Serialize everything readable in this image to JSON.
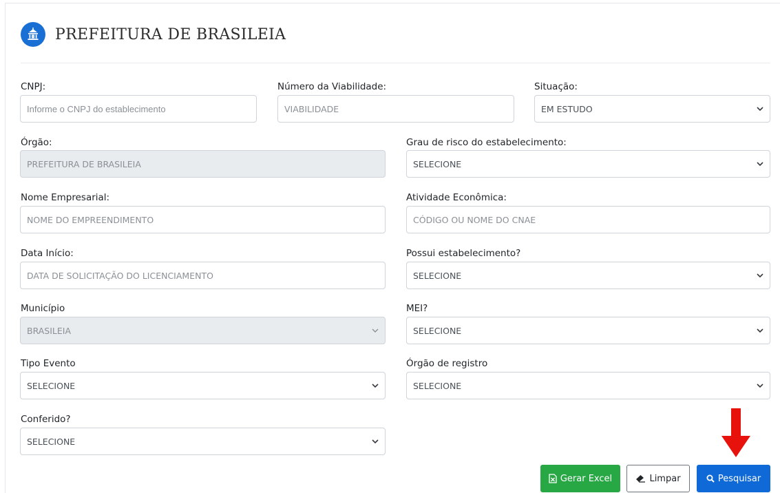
{
  "header": {
    "title": "PREFEITURA DE BRASILEIA",
    "logo_icon": "city-hall-icon",
    "accent_color": "#1a6fd4"
  },
  "form": {
    "cnpj": {
      "label": "CNPJ:",
      "placeholder": "Informe o CNPJ do establecimento"
    },
    "viabilidade": {
      "label": "Número da Viabilidade:",
      "placeholder": "VIABILIDADE"
    },
    "situacao": {
      "label": "Situação:",
      "value": "EM ESTUDO"
    },
    "orgao": {
      "label": "Órgão:",
      "value": "PREFEITURA DE BRASILEIA"
    },
    "grau_risco": {
      "label": "Grau de risco do estabelecimento:",
      "value": "SELECIONE"
    },
    "nome_empresarial": {
      "label": "Nome Empresarial:",
      "placeholder": "NOME DO EMPREENDIMENTO"
    },
    "atividade": {
      "label": "Atividade Econômica:",
      "placeholder": "CÓDIGO OU NOME DO CNAE"
    },
    "data_inicio": {
      "label": "Data Início:",
      "placeholder": "DATA DE SOLICITAÇÃO DO LICENCIAMENTO"
    },
    "possui_estab": {
      "label": "Possui estabelecimento?",
      "value": "SELECIONE"
    },
    "municipio": {
      "label": "Município",
      "value": "BRASILEIA"
    },
    "mei": {
      "label": "MEI?",
      "value": "SELECIONE"
    },
    "tipo_evento": {
      "label": "Tipo Evento",
      "value": "SELECIONE"
    },
    "orgao_registro": {
      "label": "Órgão de registro",
      "value": "SELECIONE"
    },
    "conferido": {
      "label": "Conferido?",
      "value": "SELECIONE"
    }
  },
  "actions": {
    "excel_label": "Gerar Excel",
    "clear_label": "Limpar",
    "search_label": "Pesquisar",
    "excel_color": "#28a745",
    "search_color": "#0f6ad8",
    "annotation_arrow_color": "#e8120c"
  }
}
